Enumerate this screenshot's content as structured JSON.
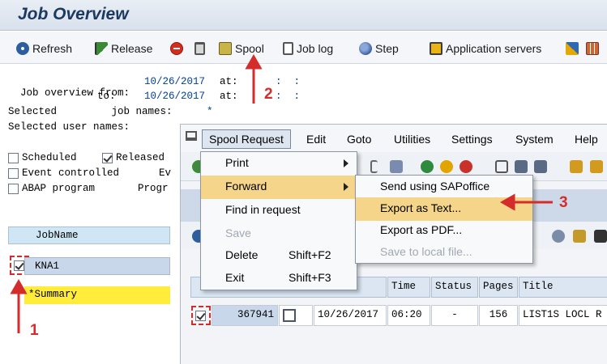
{
  "title": "Job Overview",
  "toolbar": {
    "refresh": "Refresh",
    "release": "Release",
    "spool": "Spool",
    "job_log": "Job log",
    "step": "Step",
    "application_servers": "Application servers"
  },
  "filters": {
    "from_label": "Job overview from:",
    "from_date": "10/26/2017",
    "at_label": "at:",
    "from_time": ":  :",
    "to_label": "to:",
    "to_date": "10/26/2017",
    "to_time": ":  :",
    "job_names_label": "Selected         job names:",
    "job_names_value": "*",
    "user_names_label": "Selected user names:"
  },
  "status": {
    "scheduled": "Scheduled",
    "released": "Released",
    "event_controlled": "Event controlled",
    "ev": "Ev",
    "abap_program": "ABAP program",
    "progr": "Progr"
  },
  "job_list": {
    "header": "JobName",
    "row": "KNA1",
    "summary": "*Summary"
  },
  "spool_menubar": {
    "spool_request": "Spool Request",
    "edit": "Edit",
    "goto": "Goto",
    "utilities": "Utilities",
    "settings": "Settings",
    "system": "System",
    "help": "Help"
  },
  "spool_menu": {
    "print": "Print",
    "forward": "Forward",
    "find_in_request": "Find in request",
    "save": "Save",
    "delete": "Delete",
    "delete_shortcut": "Shift+F2",
    "exit": "Exit",
    "exit_shortcut": "Shift+F3"
  },
  "forward_menu": {
    "send_sapoffice": "Send using SAPoffice",
    "export_text": "Export as Text...",
    "export_pdf": "Export as PDF...",
    "save_local": "Save to local file..."
  },
  "spool_table": {
    "headers": {
      "time": "Time",
      "status": "Status",
      "pages": "Pages",
      "title": "Title"
    },
    "row": {
      "spool_no": "367941",
      "date": "10/26/2017",
      "time": "06:20",
      "status": "-",
      "pages": "156",
      "title": "LIST1S LOCL R"
    }
  },
  "band_text": "s",
  "annotations": {
    "one": "1",
    "two": "2",
    "three": "3"
  },
  "colors": {
    "accent_red": "#d42b2b",
    "menu_highlight": "#f5d58a",
    "summary_yellow": "#ffec3b",
    "title_blue": "#1c3960"
  }
}
